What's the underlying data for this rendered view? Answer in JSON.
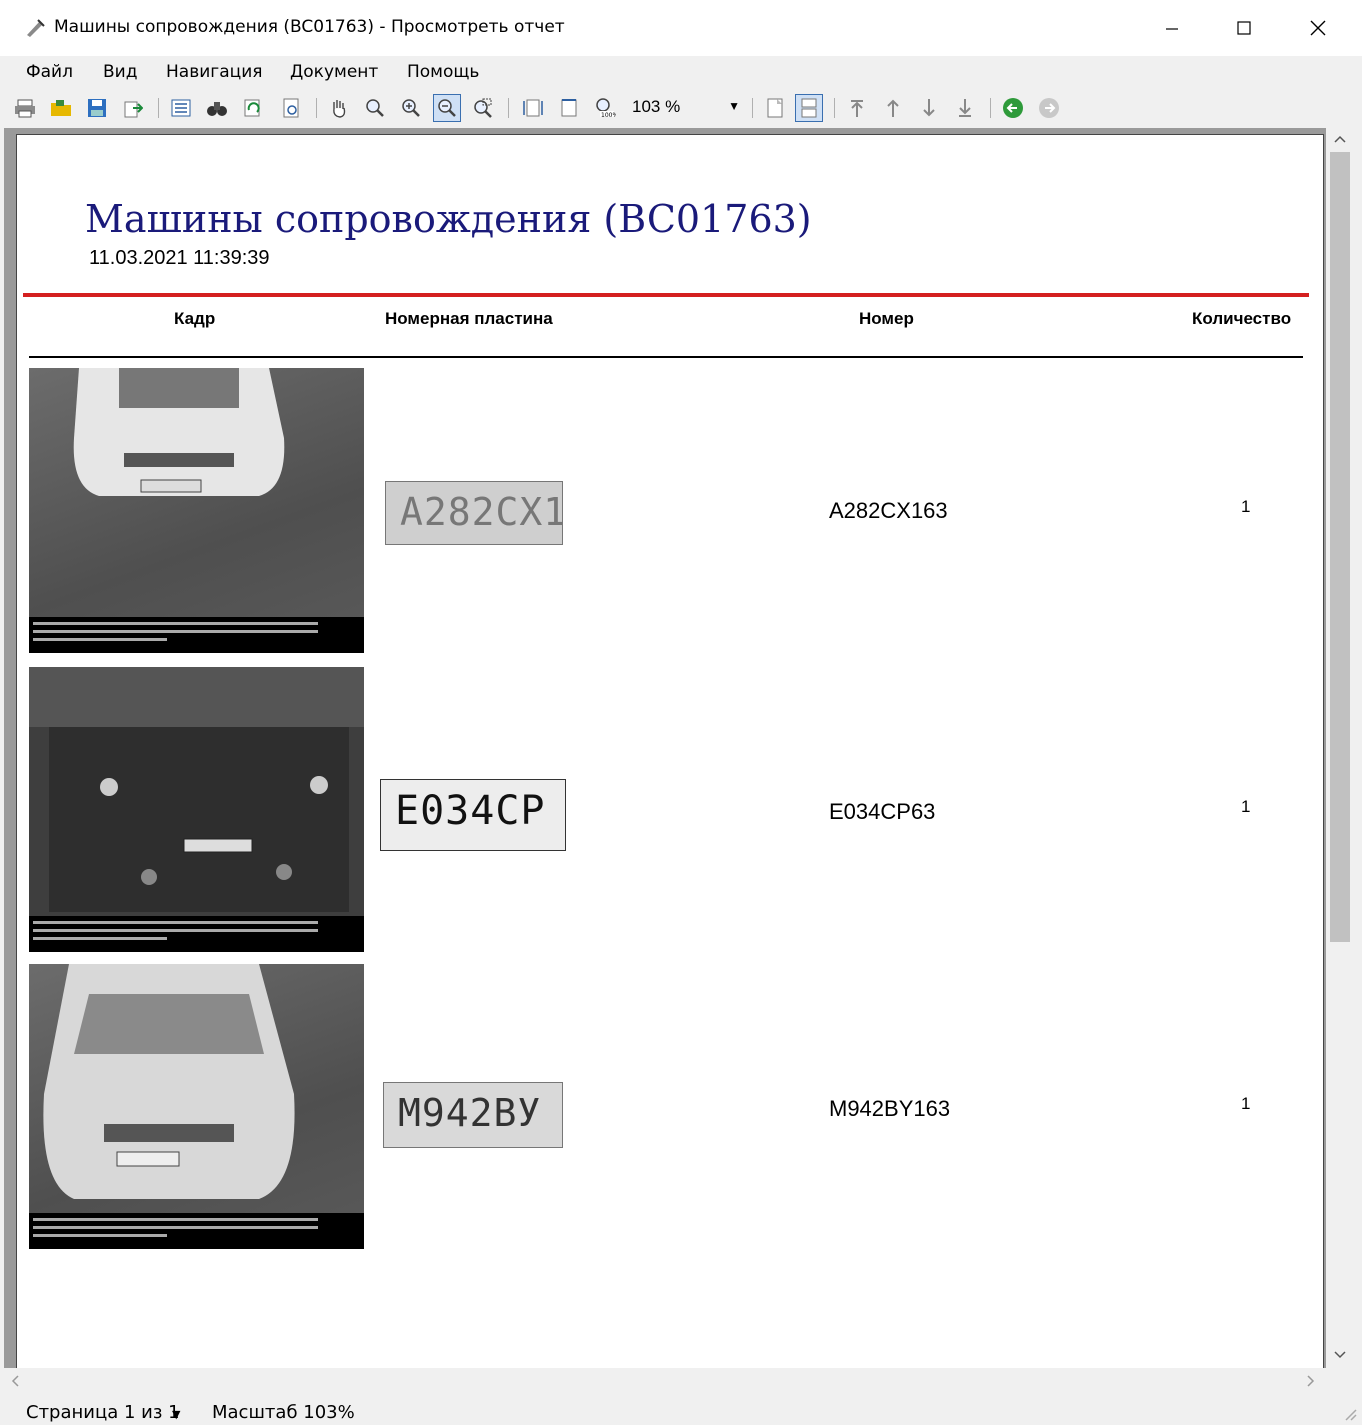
{
  "window": {
    "title": "Машины сопровождения (BC01763) - Просмотреть отчет"
  },
  "menu": [
    "Файл",
    "Вид",
    "Навигация",
    "Документ",
    "Помощь"
  ],
  "toolbar": {
    "zoom_value": "103 %"
  },
  "report": {
    "title": "Машины сопровождения (BC01763)",
    "date": "11.03.2021 11:39:39",
    "columns": {
      "frame": "Кадр",
      "plate": "Номерная пластина",
      "number": "Номер",
      "count": "Количество"
    },
    "rows": [
      {
        "plate_text": "А282СХ1",
        "number": "A282CX163",
        "count": "1"
      },
      {
        "plate_text": "Е034СР",
        "number": "E034CP63",
        "count": "1"
      },
      {
        "plate_text": "М942ВУ",
        "number": "M942BY163",
        "count": "1"
      }
    ]
  },
  "status": {
    "page": "Страница 1 из 1",
    "scale": "Масштаб 103%"
  },
  "colors": {
    "title_blue": "#1a1a7a",
    "red_rule": "#d42020"
  }
}
